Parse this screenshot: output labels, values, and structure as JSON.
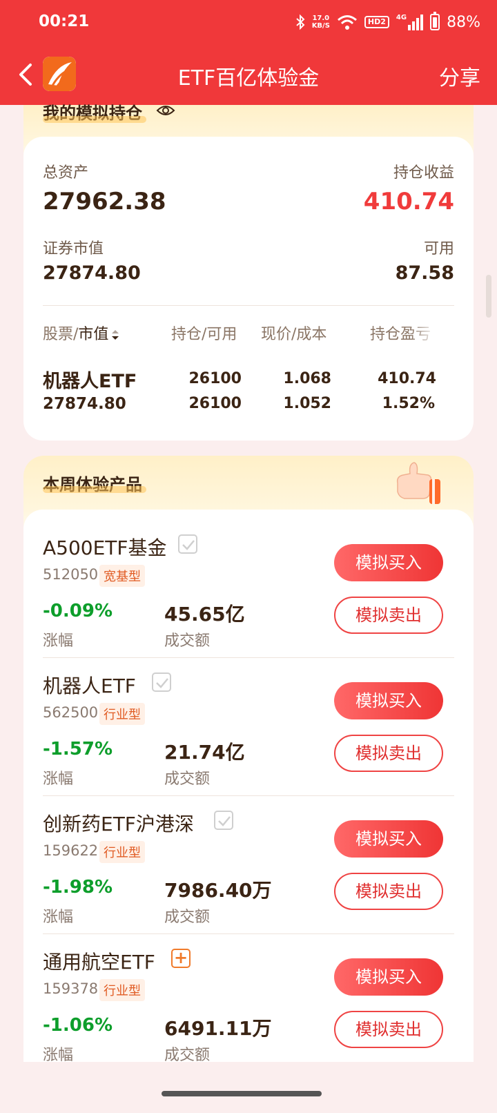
{
  "status_bar": {
    "time": "00:21",
    "net_speed_value": "17.0",
    "net_speed_unit": "KB/S",
    "hd_label": "HD2",
    "signal_label": "4G",
    "battery": "88%"
  },
  "nav": {
    "title": "ETF百亿体验金",
    "share": "分享"
  },
  "holdings": {
    "title": "我的模拟持仓",
    "total_assets_label": "总资产",
    "total_assets": "27962.38",
    "position_profit_label": "持仓收益",
    "position_profit": "410.74",
    "securities_value_label": "证券市值",
    "securities_value": "27874.80",
    "available_label": "可用",
    "available": "87.58",
    "columns": {
      "stock_label": "股票/",
      "market_value_label": "市值",
      "position_label": "持仓/可用",
      "price_label": "现价/成本",
      "pnl_label": "持仓盈亏"
    },
    "rows": [
      {
        "name": "机器人ETF",
        "market_value": "27874.80",
        "position": "26100",
        "available": "26100",
        "price": "1.068",
        "cost": "1.052",
        "pnl": "410.74",
        "pnl_pct": "1.52%"
      }
    ]
  },
  "products": {
    "title": "本周体验产品",
    "buy_label": "模拟买入",
    "sell_label": "模拟卖出",
    "change_label": "涨幅",
    "volume_label": "成交额",
    "items": [
      {
        "name": "A500ETF基金",
        "code": "512050",
        "tag": "宽基型",
        "change": "-0.09%",
        "volume": "45.65亿",
        "selected": true
      },
      {
        "name": "机器人ETF",
        "code": "562500",
        "tag": "行业型",
        "change": "-1.57%",
        "volume": "21.74亿",
        "selected": true
      },
      {
        "name": "创新药ETF沪港深",
        "code": "159622",
        "tag": "行业型",
        "change": "-1.98%",
        "volume": "7986.40万",
        "selected": true
      },
      {
        "name": "通用航空ETF",
        "code": "159378",
        "tag": "行业型",
        "change": "-1.06%",
        "volume": "6491.11万",
        "selected": false
      }
    ]
  },
  "colors": {
    "brand_red": "#f0383a",
    "gain_red": "#f03b3b",
    "loss_green": "#0d9e2b",
    "text_brown": "#3b2414"
  }
}
